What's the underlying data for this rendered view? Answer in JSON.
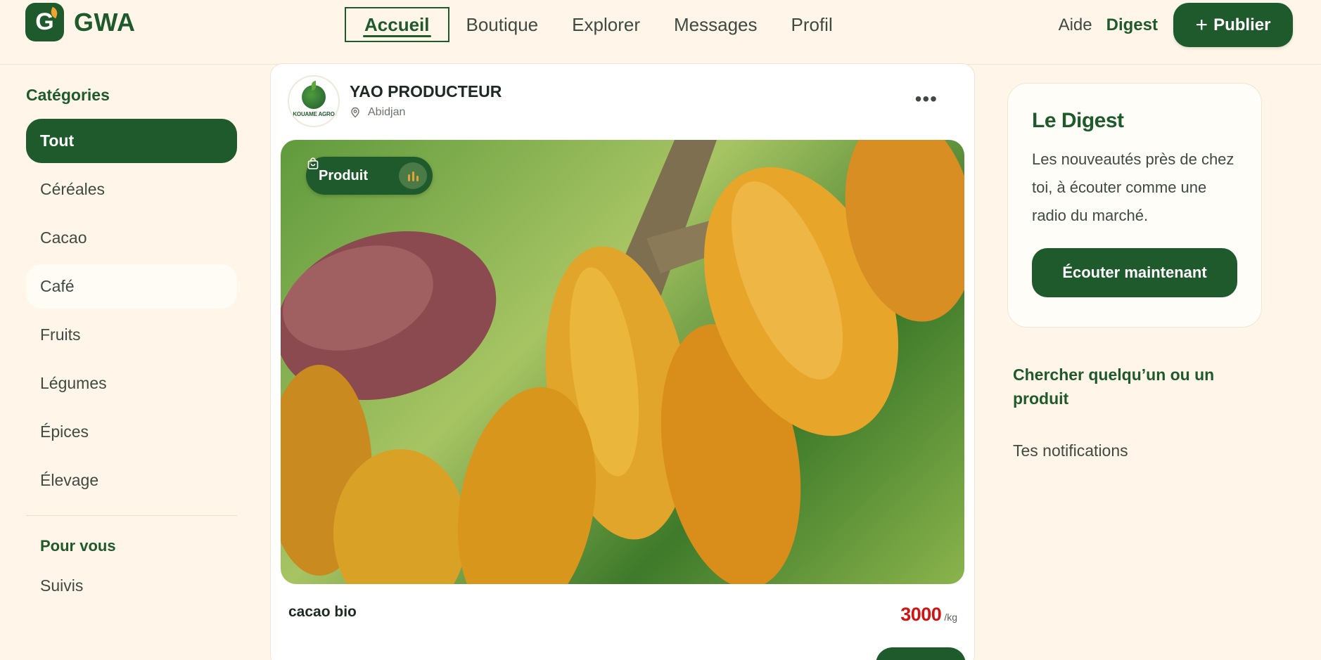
{
  "brand": {
    "logo_letter": "G",
    "name": "GWA",
    "color": "#1f5a2c"
  },
  "nav": {
    "items": [
      {
        "label": "Accueil",
        "active": true
      },
      {
        "label": "Boutique",
        "active": false
      },
      {
        "label": "Explorer",
        "active": false
      },
      {
        "label": "Messages",
        "active": false
      },
      {
        "label": "Profil",
        "active": false
      }
    ]
  },
  "header_right": {
    "help": "Aide",
    "digest": "Digest",
    "publish": "Publier",
    "publish_icon": "plus-icon"
  },
  "sidebar": {
    "title": "Catégories",
    "categories": [
      "Tout",
      "Céréales",
      "Cacao",
      "Café",
      "Fruits",
      "Légumes",
      "Épices",
      "Élevage"
    ],
    "active_category": "Tout",
    "section_title": "Pour vous",
    "section_items": [
      "Suivis"
    ]
  },
  "post": {
    "avatar_text": "KOUAME AGRO",
    "producer": "YAO PRODUCTEUR",
    "location": "Abidjan",
    "menu_icon": "more-dots-icon",
    "badge": "Produit",
    "badge_icon": "shopping-bag-icon",
    "badge_audio_icon": "audio-bars-icon",
    "title": "cacao bio",
    "price": "3000",
    "unit": "/kg",
    "price_color": "#d01414"
  },
  "digest": {
    "title": "Le Digest",
    "text": "Les nouveautés près de chez toi, à écouter comme une radio du marché.",
    "button": "Écouter maintenant"
  },
  "right_links": {
    "search": "Chercher quelqu’un ou un produit",
    "notifications": "Tes notifications"
  },
  "colors": {
    "accent": "#1f5a2c",
    "background": "#fff6e9",
    "price": "#d01414",
    "badge_audio": "#e5a236"
  }
}
